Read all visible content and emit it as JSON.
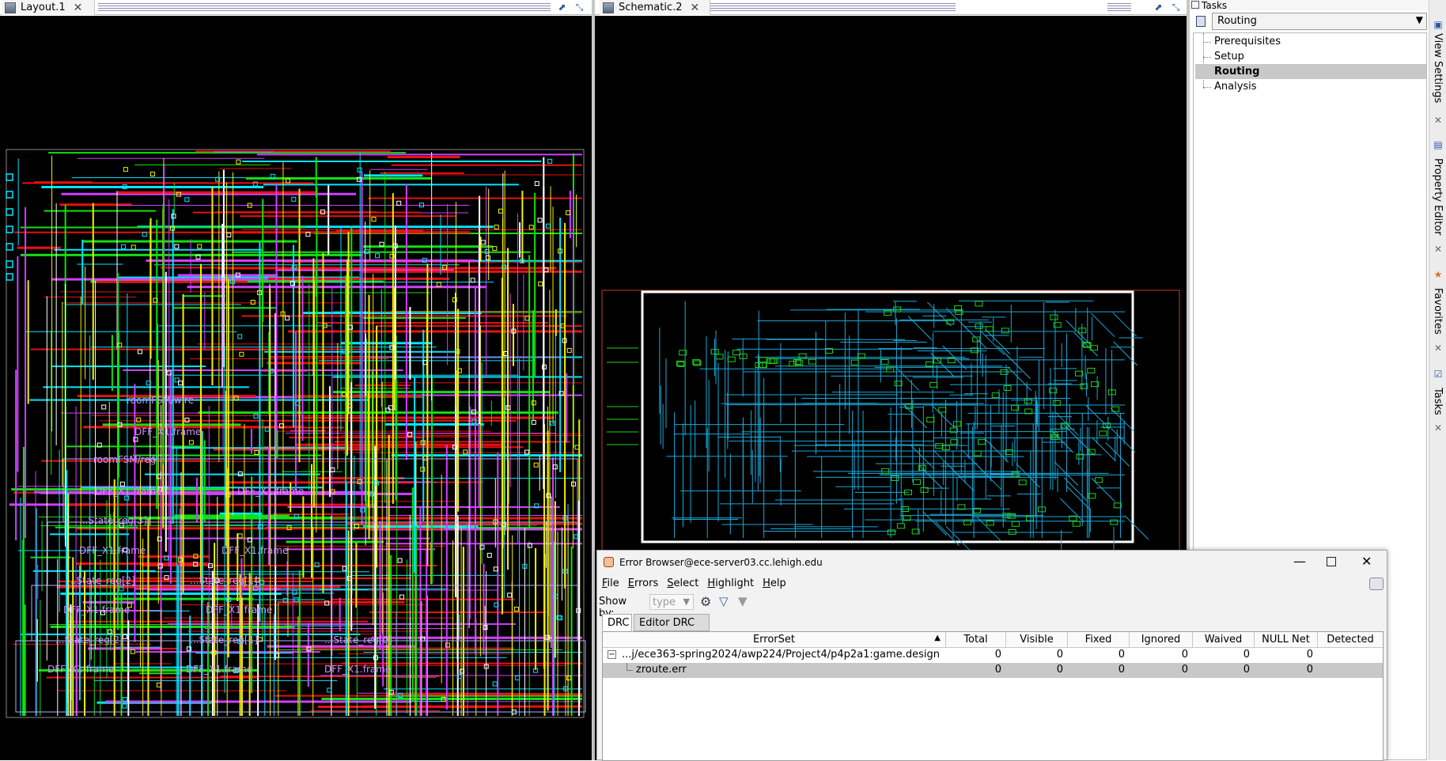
{
  "layout_pane": {
    "tab_title": "Layout.1",
    "cell_labels": [
      "roomFSM/wire",
      "DFF_X1.frame",
      "roomFSM/reg",
      "DFF_X1.frame",
      "DFF_X1.frame",
      "...State_reg[3]",
      "DFF_X1.frame",
      "DFF_X1.frame",
      "...State_reg[2]",
      "...State_reg[1]",
      "DFF_X1.frame",
      "DFF_X1.frame",
      "...State_reg[2]",
      "...State_reg[1]",
      "...State_reg[0]",
      "DFF_X1.frame",
      "DFF_X1.frame",
      "DFF_X1.frame"
    ]
  },
  "schematic_pane": {
    "tab_title": "Schematic.2"
  },
  "tasks_panel": {
    "header": "Tasks",
    "selected_flow": "Routing",
    "items": [
      "Prerequisites",
      "Setup",
      "Routing",
      "Analysis"
    ],
    "selected_item": "Routing"
  },
  "side_tabs": {
    "view_settings": "View Settings",
    "property_editor": "Property Editor",
    "favorites": "Favorites",
    "tasks": "Tasks"
  },
  "error_browser": {
    "title": "Error Browser@ece-server03.cc.lehigh.edu",
    "menus": [
      {
        "label": "File",
        "mnemonic": "F",
        "rest": "ile"
      },
      {
        "label": "Errors",
        "mnemonic": "E",
        "rest": "rrors"
      },
      {
        "label": "Select",
        "mnemonic": "S",
        "rest": "elect"
      },
      {
        "label": "Highlight",
        "mnemonic": "H",
        "rest": "ighlight"
      },
      {
        "label": "Help",
        "mnemonic": "H",
        "rest": "elp"
      }
    ],
    "show_by_label": "Show by:",
    "show_by_value": "type",
    "tabs": [
      "DRC",
      "Editor DRC"
    ],
    "active_tab": "DRC",
    "columns": [
      "ErrorSet",
      "Total",
      "Visible",
      "Fixed",
      "Ignored",
      "Waived",
      "NULL Net",
      "Detected"
    ],
    "rows": [
      {
        "name": "...j/ece363-spring2024/awp224/Project4/p4p2a1:game.design",
        "total": "0",
        "visible": "0",
        "fixed": "0",
        "ignored": "0",
        "waived": "0",
        "null_net": "0",
        "detected": ""
      },
      {
        "name": "zroute.err",
        "total": "0",
        "visible": "0",
        "fixed": "0",
        "ignored": "0",
        "waived": "0",
        "null_net": "0",
        "detected": ""
      }
    ]
  },
  "colors": {
    "layout_bg": "#000000",
    "metal_cyan": "#00e5ff",
    "metal_yellow": "#f0f000",
    "metal_magenta": "#d040ff",
    "metal_red": "#e81010",
    "metal_green": "#10e010",
    "schematic_wire": "#1aa8d8",
    "schematic_gate": "#20d020",
    "selection_row": "#c8c8c8"
  }
}
